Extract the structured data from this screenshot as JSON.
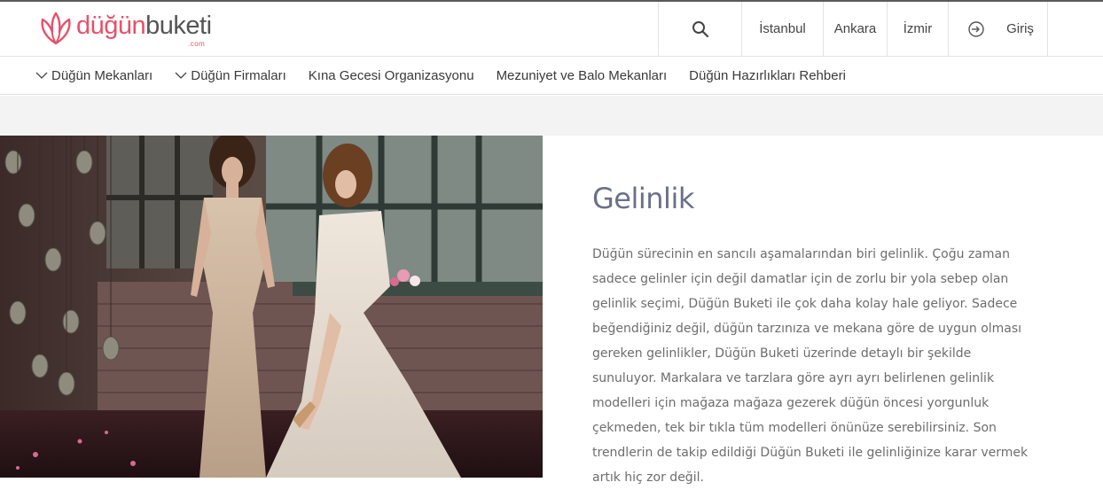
{
  "header": {
    "logo": {
      "main": "düğün",
      "accent": "buketi",
      "sub": ".com"
    },
    "search_icon": "search-icon",
    "cities": [
      "İstanbul",
      "Ankara",
      "İzmir"
    ],
    "login_label": "Giriş",
    "login_icon": "login-arrow-icon"
  },
  "nav": {
    "items": [
      {
        "label": "Düğün Mekanları",
        "has_dropdown": true
      },
      {
        "label": "Düğün Firmaları",
        "has_dropdown": true
      },
      {
        "label": "Kına Gecesi Organizasyonu",
        "has_dropdown": false
      },
      {
        "label": "Mezuniyet ve Balo Mekanları",
        "has_dropdown": false
      },
      {
        "label": "Düğün Hazırlıkları Rehberi",
        "has_dropdown": false
      }
    ]
  },
  "main": {
    "title": "Gelinlik",
    "paragraph": "Düğün sürecinin en sancılı aşamalarından biri gelinlik. Çoğu zaman sadece gelinler için değil damatlar için de zorlu bir yola sebep olan gelinlik seçimi, Düğün Buketi ile çok daha kolay hale geliyor. Sadece beğendiğiniz değil, düğün tarzınıza ve mekana göre de uygun olması gereken gelinlikler, Düğün Buketi üzerinde detaylı bir şekilde sunuluyor. Markalara ve tarzlara göre ayrı ayrı belirlenen gelinlik modelleri için mağaza mağaza gezerek düğün öncesi yorgunluk çekmeden, tek bir tıkla tüm modelleri önünüze serebilirsiniz. Son trendlerin de takip edildiği Düğün Buketi ile gelinliğinize karar vermek artık hiç zor değil."
  },
  "colors": {
    "brand": "#e8506a",
    "title": "#6b7186",
    "body_text": "#6d6d6d",
    "band": "#f3f3f3"
  }
}
